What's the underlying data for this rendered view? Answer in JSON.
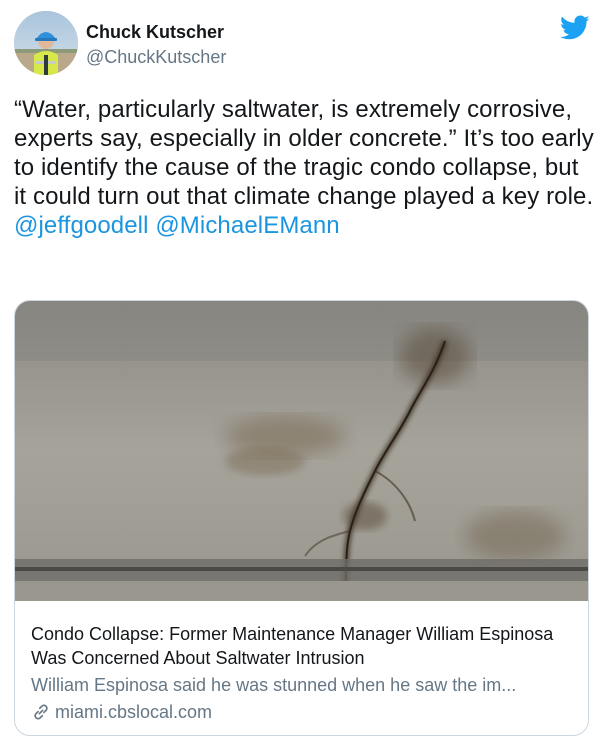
{
  "author": {
    "display_name": "Chuck Kutscher",
    "handle": "@ChuckKutscher",
    "avatar_icon": "person-in-hardhat-avatar"
  },
  "brand": {
    "icon": "twitter-bird-icon",
    "color": "#1da1f2"
  },
  "tweet": {
    "text_part1": "“Water, particularly saltwater, is extremely corrosive, experts say, especially in older concrete.” It’s too early to identify the cause of the tragic condo collapse, but it could turn out that climate change played a key role.",
    "mention1": "@jeffgoodell",
    "mention2": "@MichaelEMann",
    "mention_color": "#1b95e0"
  },
  "card": {
    "image_icon": "cracked-concrete-wall-photo",
    "title": "Condo Collapse: Former Maintenance Manager William Espinosa Was Concerned About Saltwater Intrusion",
    "description": "William Espinosa said he was stunned when he saw the im...",
    "domain": "miami.cbslocal.com",
    "link_icon": "link-icon"
  }
}
